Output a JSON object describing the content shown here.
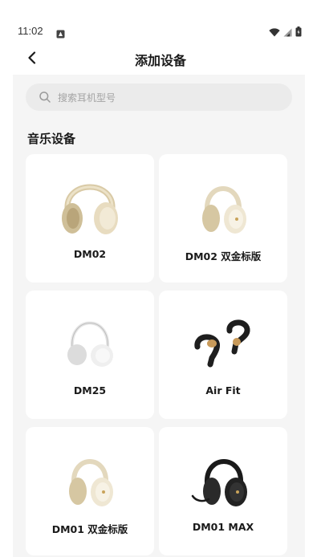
{
  "status": {
    "time": "11:02",
    "icons": [
      "notification-icon",
      "wifi-icon",
      "signal-icon",
      "battery-icon"
    ]
  },
  "header": {
    "title": "添加设备",
    "back_icon": "chevron-left-icon"
  },
  "search": {
    "placeholder": "搜索耳机型号",
    "icon": "search-icon"
  },
  "section": {
    "title": "音乐设备"
  },
  "devices": [
    {
      "name": "DM02",
      "image": "over-ear-headphones-cream"
    },
    {
      "name": "DM02 双金标版",
      "image": "over-ear-headphones-cream-gold"
    },
    {
      "name": "DM25",
      "image": "on-ear-headphones-white"
    },
    {
      "name": "Air Fit",
      "image": "open-ear-earbuds-black"
    },
    {
      "name": "DM01 双金标版",
      "image": "over-ear-headphones-cream-gold"
    },
    {
      "name": "DM01 MAX",
      "image": "gaming-headset-black"
    }
  ],
  "colors": {
    "background": "#ffffff",
    "panel": "#f5f5f5",
    "card": "#ffffff",
    "search_bg": "#ebebeb",
    "text": "#1a1a1a",
    "placeholder": "#a3a3a3"
  }
}
